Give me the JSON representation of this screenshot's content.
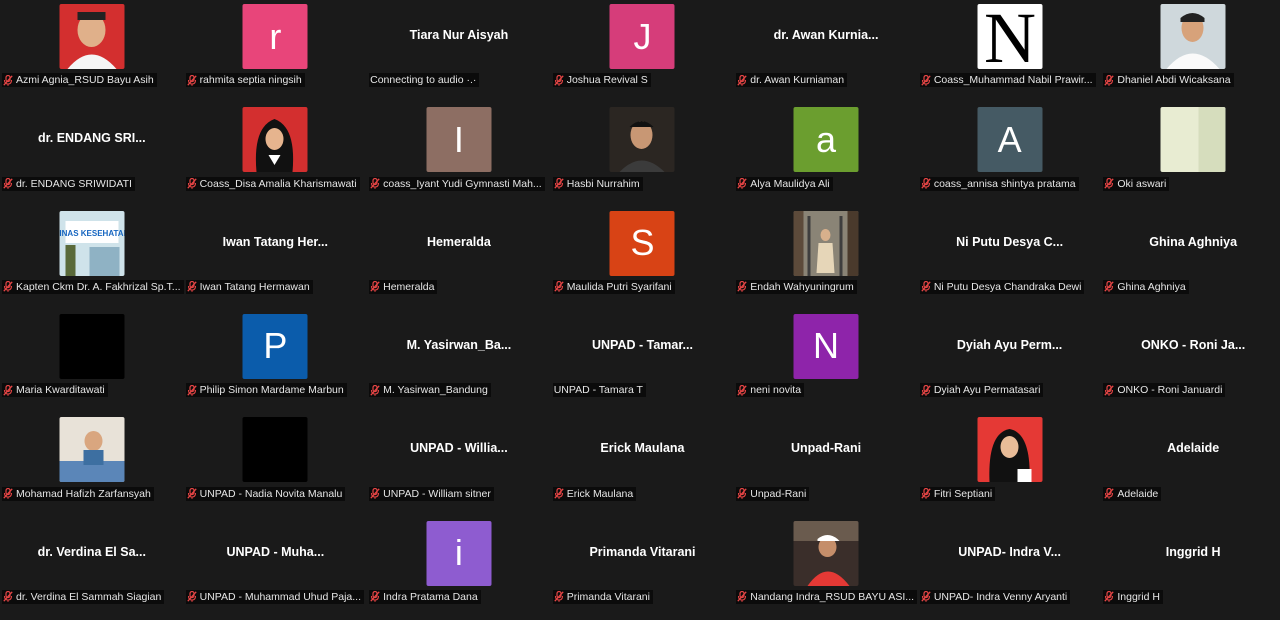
{
  "tiles": [
    {
      "label": "Azmi Agnia_RSUD Bayu Asih",
      "kind": "photo",
      "photo": "man-red",
      "muted": true
    },
    {
      "label": "rahmita septia ningsih",
      "kind": "letter",
      "letter": "r",
      "color": "#e8457a",
      "muted": true
    },
    {
      "label": "Connecting to audio ·.·",
      "kind": "name",
      "display": "Tiara Nur Aisyah",
      "muted": false
    },
    {
      "label": "Joshua Revival S",
      "kind": "letter",
      "letter": "J",
      "color": "#d63d7a",
      "muted": true
    },
    {
      "label": "dr. Awan Kurniaman",
      "kind": "name",
      "display": "dr. Awan Kurnia...",
      "muted": true
    },
    {
      "label": "Coass_Muhammad Nabil Prawir...",
      "kind": "photo",
      "photo": "n-logo",
      "muted": true
    },
    {
      "label": "Dhaniel Abdi Wicaksana",
      "kind": "photo",
      "photo": "man-white",
      "muted": true
    },
    {
      "label": "dr. ENDANG SRIWIDATI",
      "kind": "name",
      "display": "dr. ENDANG SRI...",
      "muted": true
    },
    {
      "label": "Coass_Disa Amalia Kharismawati",
      "kind": "photo",
      "photo": "hijab-red",
      "muted": true
    },
    {
      "label": "coass_Iyant Yudi Gymnasti Mah...",
      "kind": "letter",
      "letter": "I",
      "color": "#8d6e63",
      "muted": true
    },
    {
      "label": "Hasbi Nurrahim",
      "kind": "photo",
      "photo": "man-dark",
      "muted": true
    },
    {
      "label": "Alya Maulidya Ali",
      "kind": "letter",
      "letter": "a",
      "color": "#6b9e2f",
      "muted": true
    },
    {
      "label": "coass_annisa shintya pratama",
      "kind": "letter",
      "letter": "A",
      "color": "#455a64",
      "muted": true
    },
    {
      "label": "Oki aswari",
      "kind": "photo",
      "photo": "pale",
      "muted": true
    },
    {
      "label": "Kapten Ckm Dr. A. Fakhrizal Sp.T...",
      "kind": "photo",
      "photo": "dinas",
      "muted": true
    },
    {
      "label": "Iwan Tatang Hermawan",
      "kind": "name",
      "display": "Iwan Tatang Her...",
      "muted": true
    },
    {
      "label": "Hemeralda",
      "kind": "name",
      "display": "Hemeralda",
      "muted": true
    },
    {
      "label": "Maulida Putri Syarifani",
      "kind": "letter",
      "letter": "S",
      "color": "#d84315",
      "muted": true
    },
    {
      "label": "Endah Wahyuningrum",
      "kind": "photo",
      "photo": "woman-street",
      "muted": true
    },
    {
      "label": "Ni Putu Desya Chandraka Dewi",
      "kind": "name",
      "display": "Ni Putu Desya C...",
      "muted": true
    },
    {
      "label": "Ghina Aghniya",
      "kind": "name",
      "display": "Ghina Aghniya",
      "muted": true
    },
    {
      "label": "Maria Kwarditawati",
      "kind": "photo",
      "photo": "black",
      "muted": true
    },
    {
      "label": "Philip Simon Mardame Marbun",
      "kind": "letter",
      "letter": "P",
      "color": "#0b5cab",
      "muted": true
    },
    {
      "label": "M. Yasirwan_Bandung",
      "kind": "name",
      "display": "M. Yasirwan_Ba...",
      "muted": true
    },
    {
      "label": "UNPAD - Tamara T",
      "kind": "name",
      "display": "UNPAD - Tamar...",
      "muted": false
    },
    {
      "label": "neni novita",
      "kind": "letter",
      "letter": "N",
      "color": "#8e24aa",
      "muted": true
    },
    {
      "label": "Dyiah Ayu Permatasari",
      "kind": "name",
      "display": "Dyiah Ayu Perm...",
      "muted": true
    },
    {
      "label": "ONKO - Roni Januardi",
      "kind": "name",
      "display": "ONKO - Roni Ja...",
      "muted": true
    },
    {
      "label": "Mohamad Hafizh Zarfansyah",
      "kind": "photo",
      "photo": "baby",
      "muted": true
    },
    {
      "label": "UNPAD - Nadia Novita Manalu",
      "kind": "photo",
      "photo": "black",
      "muted": true
    },
    {
      "label": "UNPAD - William sitner",
      "kind": "name",
      "display": "UNPAD - Willia...",
      "muted": true
    },
    {
      "label": "Erick Maulana",
      "kind": "name",
      "display": "Erick Maulana",
      "muted": true
    },
    {
      "label": "Unpad-Rani",
      "kind": "name",
      "display": "Unpad-Rani",
      "muted": true
    },
    {
      "label": "Fitri Septiani",
      "kind": "photo",
      "photo": "hijab-red2",
      "muted": true
    },
    {
      "label": "Adelaide",
      "kind": "name",
      "display": "Adelaide",
      "muted": true
    },
    {
      "label": "dr. Verdina El Sammah Siagian",
      "kind": "name",
      "display": "dr. Verdina El Sa...",
      "muted": true
    },
    {
      "label": "UNPAD - Muhammad Uhud Paja...",
      "kind": "name",
      "display": "UNPAD - Muha...",
      "muted": true
    },
    {
      "label": "Indra Pratama Dana",
      "kind": "letter",
      "letter": "i",
      "color": "#8e5cd0",
      "muted": true
    },
    {
      "label": "Primanda Vitarani",
      "kind": "name",
      "display": "Primanda Vitarani",
      "muted": true
    },
    {
      "label": "Nandang Indra_RSUD BAYU ASI...",
      "kind": "photo",
      "photo": "man-cap",
      "muted": true
    },
    {
      "label": "UNPAD- Indra Venny Aryanti",
      "kind": "name",
      "display": "UNPAD- Indra V...",
      "muted": true
    },
    {
      "label": "Inggrid H",
      "kind": "name",
      "display": "Inggrid H",
      "muted": true
    }
  ]
}
